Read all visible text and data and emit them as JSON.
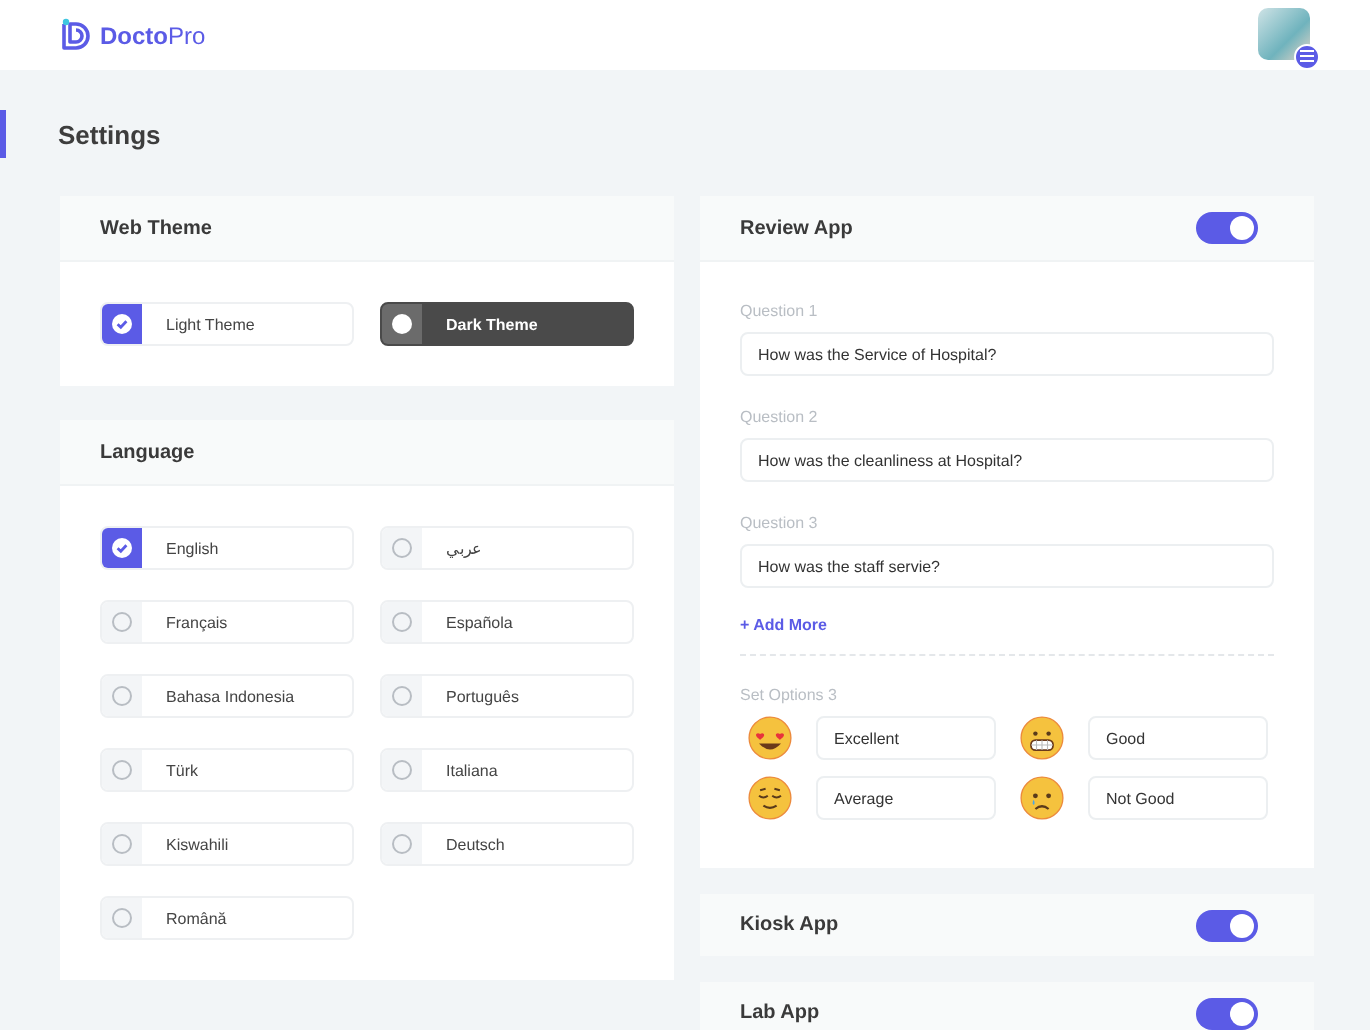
{
  "header": {
    "logo": "**Docto**Pro"
  },
  "page": {
    "title": "Settings"
  },
  "web_theme": {
    "title": "Web Theme",
    "options": [
      {
        "label": "Light Theme",
        "kind": "light",
        "selected": true
      },
      {
        "label": "Dark Theme",
        "kind": "dark",
        "selected": false
      }
    ]
  },
  "language": {
    "title": "Language",
    "options": [
      {
        "label": "English",
        "selected": true
      },
      {
        "label": "عربي",
        "selected": false
      },
      {
        "label": "Français",
        "selected": false
      },
      {
        "label": "Española",
        "selected": false
      },
      {
        "label": "Bahasa Indonesia",
        "selected": false
      },
      {
        "label": "Português",
        "selected": false
      },
      {
        "label": "Türk",
        "selected": false
      },
      {
        "label": "Italiana",
        "selected": false
      },
      {
        "label": "Kiswahili",
        "selected": false
      },
      {
        "label": "Deutsch",
        "selected": false
      },
      {
        "label": "Română",
        "selected": false
      }
    ]
  },
  "review_app": {
    "title": "Review App",
    "on": true,
    "questions": [
      {
        "label": "Question 1",
        "value": "How was the Service of Hospital?"
      },
      {
        "label": "Question 2",
        "value": "How was the cleanliness at Hospital?"
      },
      {
        "label": "Question 3",
        "value": "How was the staff servie?"
      }
    ],
    "add_more": "+ Add More",
    "options_label": "Set Options 3",
    "options": [
      {
        "kind": "heart-eyes",
        "label": "Excellent"
      },
      {
        "kind": "grin",
        "label": "Good"
      },
      {
        "kind": "relieved",
        "label": "Average"
      },
      {
        "kind": "crying",
        "label": "Not Good"
      }
    ]
  },
  "kiosk_app": {
    "title": "Kiosk App",
    "on": true
  },
  "lab_app": {
    "title": "Lab App",
    "on": true
  }
}
